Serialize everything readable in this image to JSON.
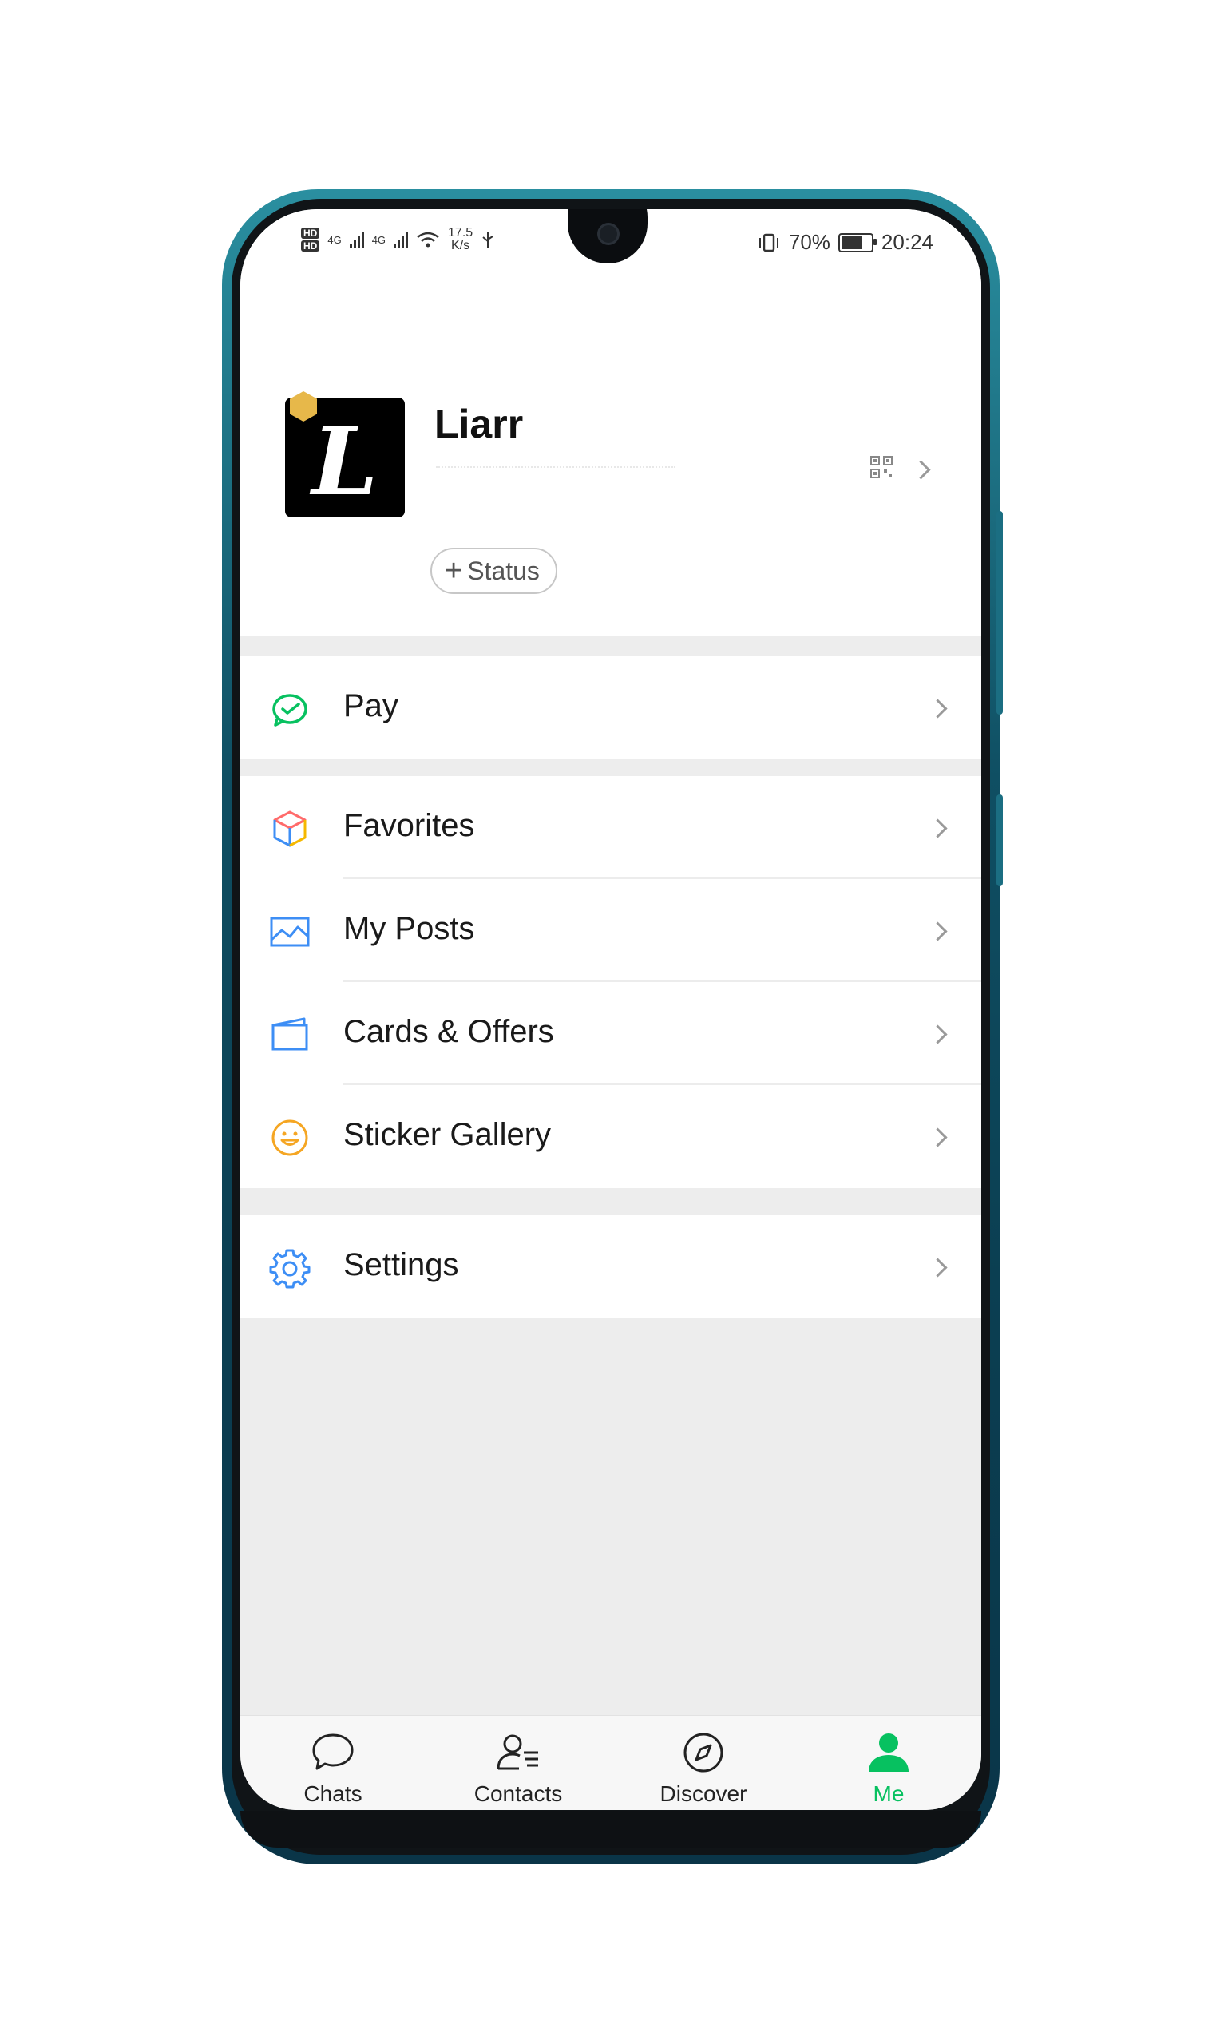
{
  "status_bar": {
    "hd_top": "HD",
    "hd_bottom": "HD",
    "net1": "4G",
    "net2": "4G",
    "speed_value": "17.5",
    "speed_unit": "K/s",
    "battery": "70%",
    "time": "20:24",
    "battery_level": 0.7
  },
  "profile": {
    "name": "Liarr",
    "avatar_letter": "L",
    "status_button": "Status"
  },
  "menu": {
    "pay": "Pay",
    "favorites": "Favorites",
    "my_posts": "My Posts",
    "cards_offers": "Cards & Offers",
    "sticker_gallery": "Sticker Gallery",
    "settings": "Settings"
  },
  "tabs": [
    {
      "label": "Chats",
      "icon": "chat-bubble-icon",
      "active": false
    },
    {
      "label": "Contacts",
      "icon": "contacts-icon",
      "active": false
    },
    {
      "label": "Discover",
      "icon": "compass-icon",
      "active": false
    },
    {
      "label": "Me",
      "icon": "person-icon",
      "active": true
    }
  ],
  "colors": {
    "accent": "#07c160",
    "frame": "#0f4f63",
    "background": "#ededed"
  }
}
